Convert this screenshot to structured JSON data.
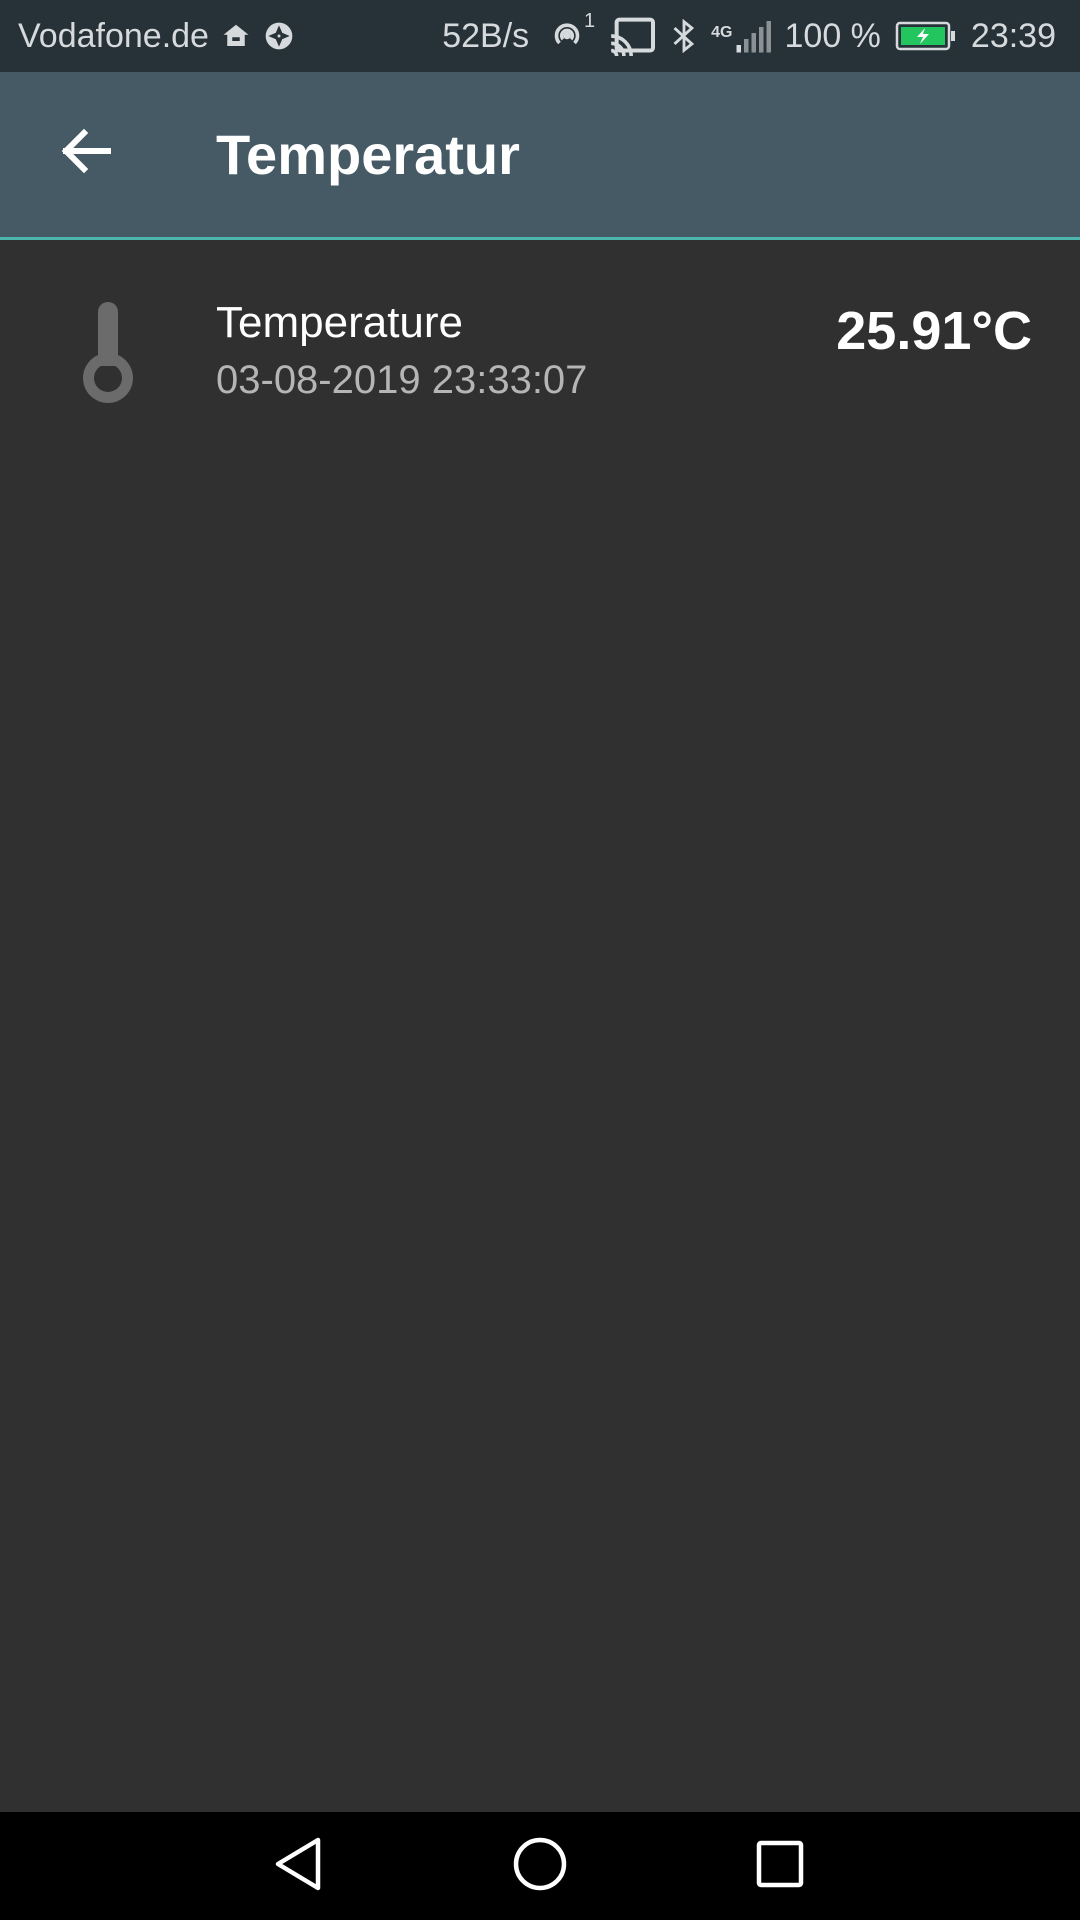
{
  "status_bar": {
    "carrier": "Vodafone.de",
    "net_speed": "52B/s",
    "battery": "100 %",
    "time": "23:39",
    "icons": [
      "home-icon",
      "aperture-icon",
      "hotspot-icon",
      "cast-icon",
      "bluetooth-icon",
      "4g-signal-icon",
      "battery-icon"
    ],
    "hotspot_badge": "1",
    "network_type": "4G"
  },
  "app_bar": {
    "title": "Temperatur",
    "back_icon": "arrow-left-icon"
  },
  "list": {
    "items": [
      {
        "icon": "thermometer-icon",
        "title": "Temperature",
        "timestamp": "03-08-2019 23:33:07",
        "value": "25.91°C"
      }
    ]
  },
  "nav_bar": {
    "icons": [
      "back-triangle-icon",
      "home-circle-icon",
      "recents-square-icon"
    ]
  },
  "colors": {
    "status_bar": "#263238",
    "app_bar": "#455a64",
    "accent": "#4db6ac",
    "background": "#303030",
    "battery_fill": "#22c55e"
  }
}
